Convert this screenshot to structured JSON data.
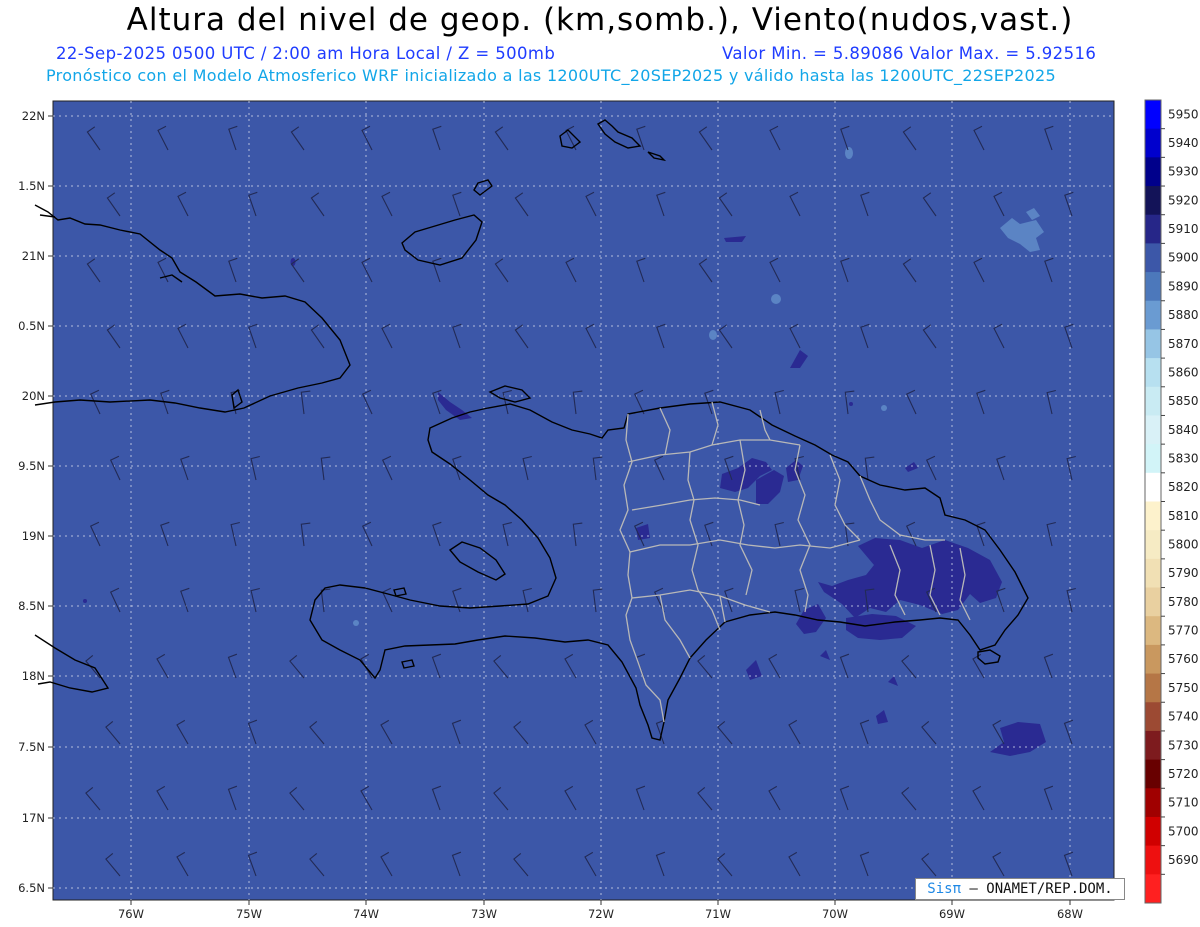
{
  "header": {
    "title": "Altura del nivel de geop. (km,somb.), Viento(nudos,vast.)",
    "subtitle_time": "22-Sep-2025  0500 UTC / 2:00 am Hora Local / Z = 500mb",
    "subtitle_minmax": "Valor Min. = 5.89086  Valor Max. = 5.92516",
    "subtitle_model": "Pronóstico con el Modelo Atmosferico WRF inicializado a las 1200UTC_20SEP2025 y válido hasta las  1200UTC_22SEP2025"
  },
  "map": {
    "lat_labels": [
      "22N",
      "1.5N",
      "21N",
      "0.5N",
      "20N",
      "9.5N",
      "19N",
      "8.5N",
      "18N",
      "7.5N",
      "17N",
      "6.5N"
    ],
    "lon_labels": [
      "76W",
      "75W",
      "74W",
      "73W",
      "72W",
      "71W",
      "70W",
      "69W",
      "68W"
    ],
    "background_color": "#3c57a8",
    "contour_high_color": "#2a2a92",
    "contour_low_color": "#5b84c4",
    "land_border_color": "#000000",
    "province_border_color": "#b4b4b4"
  },
  "colorbar": {
    "levels": [
      "5950",
      "5940",
      "5930",
      "5920",
      "5910",
      "5900",
      "5890",
      "5880",
      "5870",
      "5860",
      "5850",
      "5840",
      "5830",
      "5820",
      "5810",
      "5800",
      "5790",
      "5780",
      "5770",
      "5760",
      "5750",
      "5740",
      "5730",
      "5720",
      "5710",
      "5700",
      "5690"
    ],
    "colors": [
      "#0000ff",
      "#0000cd",
      "#00008b",
      "#131358",
      "#262688",
      "#3c57a8",
      "#4c78bb",
      "#6a9bd2",
      "#96c5e5",
      "#b7e0f0",
      "#c9ebf3",
      "#d9f1f7",
      "#d2f4f8",
      "#ffffff",
      "#fdf2cc",
      "#f6ebc4",
      "#f1e0b4",
      "#e9d0a0",
      "#dcb880",
      "#c9985f",
      "#b57646",
      "#9c4a33",
      "#7d1b1e",
      "#680000",
      "#a00000",
      "#d00000",
      "#ee1010",
      "#ff2020"
    ]
  },
  "credit": {
    "brand": "Sisπ",
    "text": " – ONAMET/REP.DOM."
  }
}
